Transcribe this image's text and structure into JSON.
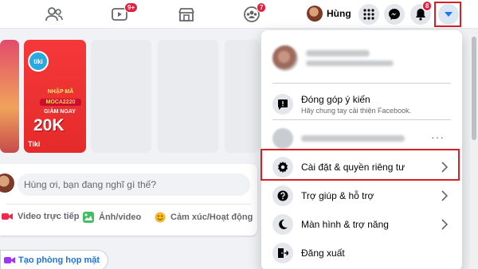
{
  "nav": {
    "watch_badge": "9+",
    "groups_badge": "7",
    "profile_name": "Hùng",
    "notifications_badge": "8"
  },
  "stories": {
    "tiki": {
      "brand": "tiki",
      "headline": "NHẬP MÃ",
      "code": "MOCA2220",
      "discount_label": "GIẢM NGAY",
      "amount": "20K",
      "author": "Tiki"
    }
  },
  "composer": {
    "placeholder": "Hùng ơi, bạn đang nghĩ gì thế?",
    "actions": [
      {
        "label": "Video trực tiếp",
        "icon": "live-video-icon"
      },
      {
        "label": "Ảnh/video",
        "icon": "photo-icon"
      },
      {
        "label": "Cảm xúc/Hoạt động",
        "icon": "feeling-icon"
      }
    ],
    "meet_button": "Tạo phòng họp mặt"
  },
  "menu": {
    "feedback": {
      "title": "Đóng góp ý kiến",
      "subtitle": "Hãy chung tay cải thiện Facebook."
    },
    "items": [
      {
        "label": "Cài đặt & quyền riêng tư",
        "icon": "gear-icon"
      },
      {
        "label": "Trợ giúp & hỗ trợ",
        "icon": "question-icon"
      },
      {
        "label": "Màn hình & trợ năng",
        "icon": "moon-icon"
      },
      {
        "label": "Đăng xuất",
        "icon": "logout-icon"
      }
    ],
    "more_dots": "···"
  },
  "colors": {
    "accent": "#1877f2",
    "highlight_box": "#d81f26",
    "badge": "#e41e3f"
  }
}
